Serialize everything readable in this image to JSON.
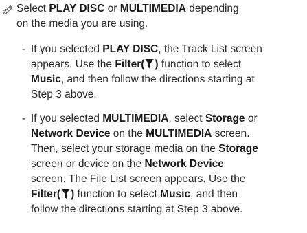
{
  "note": {
    "icon": "pencil-note-icon",
    "lines": [
      [
        "Select ",
        "PLAY DISC",
        " or ",
        "MULTIMEDIA",
        " depending"
      ],
      [
        "on the media you are using."
      ]
    ]
  },
  "items": [
    {
      "dash": "-",
      "lines": [
        [
          "If you selected ",
          "PLAY DISC",
          ", the Track List screen"
        ],
        [
          "appears. Use the ",
          "Filter(",
          "",
          ")",
          " function to select"
        ],
        [
          "Music",
          ", and then follow the directions starting at"
        ],
        [
          "Step 3 above."
        ]
      ]
    },
    {
      "dash": "-",
      "lines": [
        [
          "If you selected ",
          "MULTIMEDIA",
          ", select ",
          "Storage",
          " or"
        ],
        [
          "Network Device",
          " on the ",
          "MULTIMEDIA",
          " screen."
        ],
        [
          "Then, select your storage media on the ",
          "Storage"
        ],
        [
          "screen or device on the ",
          "Network Device"
        ],
        [
          "screen. The File List screen appears. Use the"
        ],
        [
          "Filter(",
          "",
          ")",
          " function to select ",
          "Music",
          ", and then"
        ],
        [
          "follow the directions starting at Step 3 above."
        ]
      ]
    }
  ],
  "filter_icon": "filter-funnel-icon",
  "colors": {
    "text": "#2b2b2b",
    "bold": "#1a1a1a",
    "icon": "#555555"
  }
}
